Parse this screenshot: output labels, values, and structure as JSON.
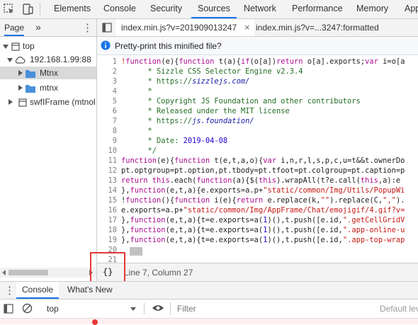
{
  "toolbar": {
    "tabs": [
      "Elements",
      "Console",
      "Security",
      "Sources",
      "Network",
      "Performance",
      "Memory",
      "App"
    ],
    "active_tab": "Sources"
  },
  "sidebar": {
    "tab_label": "Page",
    "more_label": "»",
    "tree": [
      {
        "label": "top",
        "icon": "frame-icon"
      },
      {
        "label": "192.168.1.99:88",
        "icon": "cloud-icon"
      },
      {
        "label": "Mtnx",
        "icon": "folder-icon"
      },
      {
        "label": "mtnx",
        "icon": "folder-icon"
      },
      {
        "label": "swfIFrame (mtnol",
        "icon": "frame-icon"
      }
    ]
  },
  "editor": {
    "tabs": [
      {
        "label": "index.min.js?v=201909013247",
        "active": true
      },
      {
        "label": "index.min.js?v=...3247:formatted",
        "active": false
      }
    ],
    "infobar_text": "Pretty-print this minified file?",
    "status_text": "Line 7, Column 27",
    "pretty_print_label": "{}",
    "gutter": [
      "1",
      "2",
      "3",
      "4",
      "5",
      "6",
      "7",
      "8",
      "9",
      "10",
      "11",
      "12",
      "13",
      "14",
      "15",
      "16",
      "17",
      "18",
      "19",
      "20",
      "21"
    ]
  },
  "drawer": {
    "tabs": [
      "Console",
      "What's New"
    ],
    "context": "top",
    "filter_placeholder": "Filter",
    "levels": "Default lev"
  },
  "colors": {
    "accent": "#1a73e8",
    "highlight_box": "#e53935",
    "folder": "#4a90d9"
  }
}
